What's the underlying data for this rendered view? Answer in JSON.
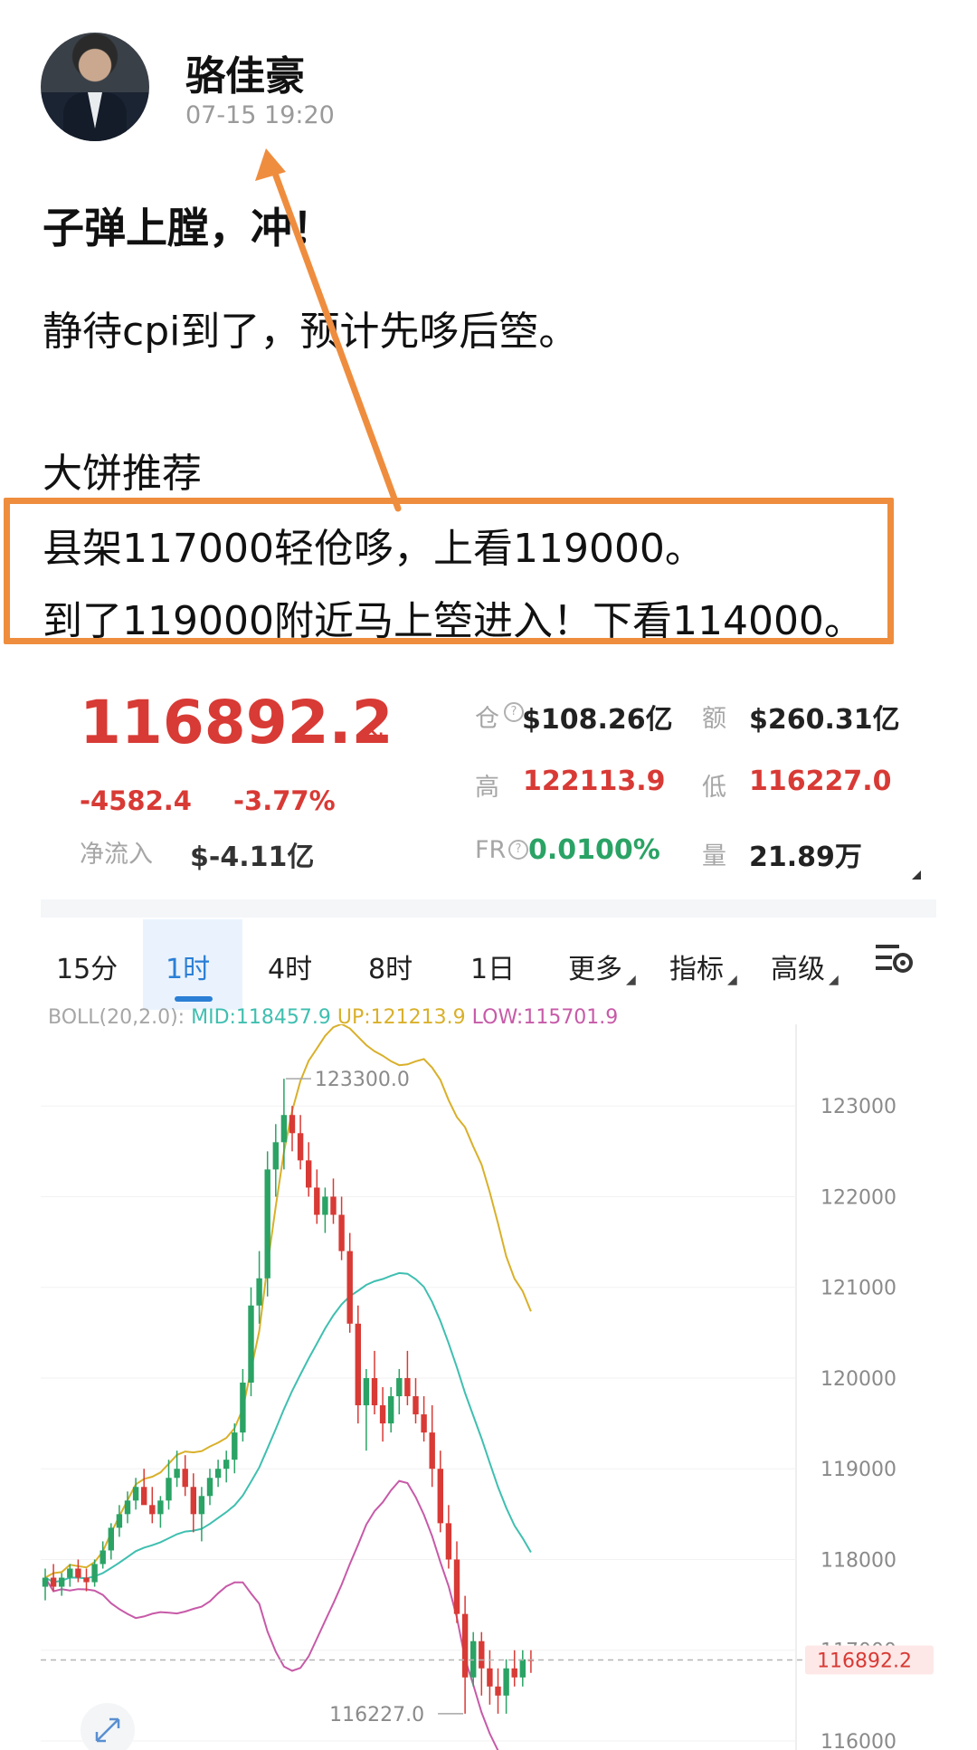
{
  "post": {
    "author": "骆佳豪",
    "timestamp": "07-15 19:20",
    "title": "子弹上膛，冲！",
    "line1": "静待cpi到了，预计先哆后箜。",
    "line2": "大饼推荐",
    "line3": "县架117000轻伧哆，上看119000。",
    "line4": "到了119000附近马上箜进入！下看114000。"
  },
  "ticker": {
    "price": "116892.2",
    "change": "-4582.4",
    "change_pct": "-3.77%",
    "net_inflow_label": "净流入",
    "net_inflow": "$-4.11亿",
    "oi_label": "仓",
    "oi_value": "$108.26亿",
    "turnover_label": "额",
    "turnover_value": "$260.31亿",
    "high_label": "高",
    "high_value": "122113.9",
    "low_label": "低",
    "low_value": "116227.0",
    "fr_label": "FR",
    "fr_value": "0.0100%",
    "volume_label": "量",
    "volume_value": "21.89万"
  },
  "tabs": [
    {
      "label": "15分"
    },
    {
      "label": "1时",
      "active": true
    },
    {
      "label": "4时"
    },
    {
      "label": "8时"
    },
    {
      "label": "1日"
    },
    {
      "label": "更多"
    },
    {
      "label": "指标"
    },
    {
      "label": "高级"
    }
  ],
  "indicator": {
    "name": "BOLL(20,2.0):",
    "mid": "MID:118457.9",
    "up": "UP:121213.9",
    "low": "LOW:115701.9"
  },
  "chart_data": {
    "type": "candlestick",
    "y_ticks": [
      "123000",
      "122000",
      "121000",
      "120000",
      "119000",
      "118000",
      "117000",
      "116000"
    ],
    "y_range": [
      115900,
      123900
    ],
    "current_price_label": "116892.2",
    "max_label": "123300.0",
    "min_label": "116227.0",
    "candles": [
      [
        117700,
        117900,
        117550,
        117800
      ],
      [
        117800,
        117950,
        117650,
        117700
      ],
      [
        117700,
        117850,
        117600,
        117800
      ],
      [
        117800,
        117950,
        117700,
        117900
      ],
      [
        117900,
        118000,
        117750,
        117800
      ],
      [
        117800,
        117900,
        117650,
        117750
      ],
      [
        117750,
        118000,
        117700,
        117950
      ],
      [
        117950,
        118200,
        117900,
        118100
      ],
      [
        118100,
        118400,
        118000,
        118350
      ],
      [
        118350,
        118600,
        118250,
        118500
      ],
      [
        118500,
        118750,
        118400,
        118650
      ],
      [
        118650,
        118900,
        118550,
        118800
      ],
      [
        118800,
        119000,
        118700,
        118600
      ],
      [
        118600,
        118800,
        118400,
        118500
      ],
      [
        118500,
        118700,
        118350,
        118650
      ],
      [
        118650,
        119100,
        118550,
        118900
      ],
      [
        118900,
        119200,
        118800,
        119000
      ],
      [
        119000,
        119150,
        118700,
        118800
      ],
      [
        118800,
        118950,
        118300,
        118500
      ],
      [
        118500,
        118800,
        118200,
        118700
      ],
      [
        118700,
        119000,
        118600,
        118900
      ],
      [
        118900,
        119100,
        118800,
        119000
      ],
      [
        119000,
        119200,
        118850,
        119100
      ],
      [
        119100,
        119500,
        118950,
        119400
      ],
      [
        119400,
        120100,
        119300,
        119950
      ],
      [
        119950,
        121000,
        119800,
        120800
      ],
      [
        120800,
        121400,
        120600,
        121100
      ],
      [
        121100,
        122500,
        120900,
        122300
      ],
      [
        122300,
        122800,
        122000,
        122600
      ],
      [
        122600,
        123300,
        122300,
        122900
      ],
      [
        122900,
        123000,
        122500,
        122700
      ],
      [
        122700,
        122900,
        122300,
        122400
      ],
      [
        122400,
        122600,
        122000,
        122100
      ],
      [
        122100,
        122300,
        121700,
        121800
      ],
      [
        121800,
        122100,
        121600,
        122000
      ],
      [
        122000,
        122200,
        121700,
        121800
      ],
      [
        121800,
        122000,
        121300,
        121400
      ],
      [
        121400,
        121600,
        120500,
        120600
      ],
      [
        120600,
        120800,
        119500,
        119700
      ],
      [
        119700,
        120100,
        119200,
        120000
      ],
      [
        120000,
        120300,
        119600,
        119700
      ],
      [
        119700,
        119900,
        119300,
        119500
      ],
      [
        119500,
        119900,
        119400,
        119800
      ],
      [
        119800,
        120100,
        119600,
        120000
      ],
      [
        120000,
        120300,
        119700,
        119800
      ],
      [
        119800,
        120000,
        119500,
        119600
      ],
      [
        119600,
        119800,
        119300,
        119400
      ],
      [
        119400,
        119700,
        118800,
        119000
      ],
      [
        119000,
        119200,
        118300,
        118400
      ],
      [
        118400,
        118600,
        117900,
        118000
      ],
      [
        118000,
        118200,
        117300,
        117400
      ],
      [
        117400,
        117600,
        116300,
        116700
      ],
      [
        116700,
        117200,
        116600,
        117100
      ],
      [
        117100,
        117200,
        116500,
        116800
      ],
      [
        116800,
        117000,
        116400,
        116600
      ],
      [
        116600,
        116800,
        116300,
        116500
      ],
      [
        116500,
        116900,
        116300,
        116800
      ],
      [
        116800,
        117000,
        116600,
        116700
      ],
      [
        116700,
        117000,
        116600,
        116900
      ],
      [
        116900,
        117000,
        116750,
        116892
      ]
    ]
  },
  "colors": {
    "up": "#2aa365",
    "down": "#d83a35",
    "boll_mid": "#3fbfb0",
    "boll_up": "#d9b02a",
    "boll_low": "#c75aa8",
    "highlight_box": "#ef8d3e",
    "accent": "#2b7fd5"
  }
}
